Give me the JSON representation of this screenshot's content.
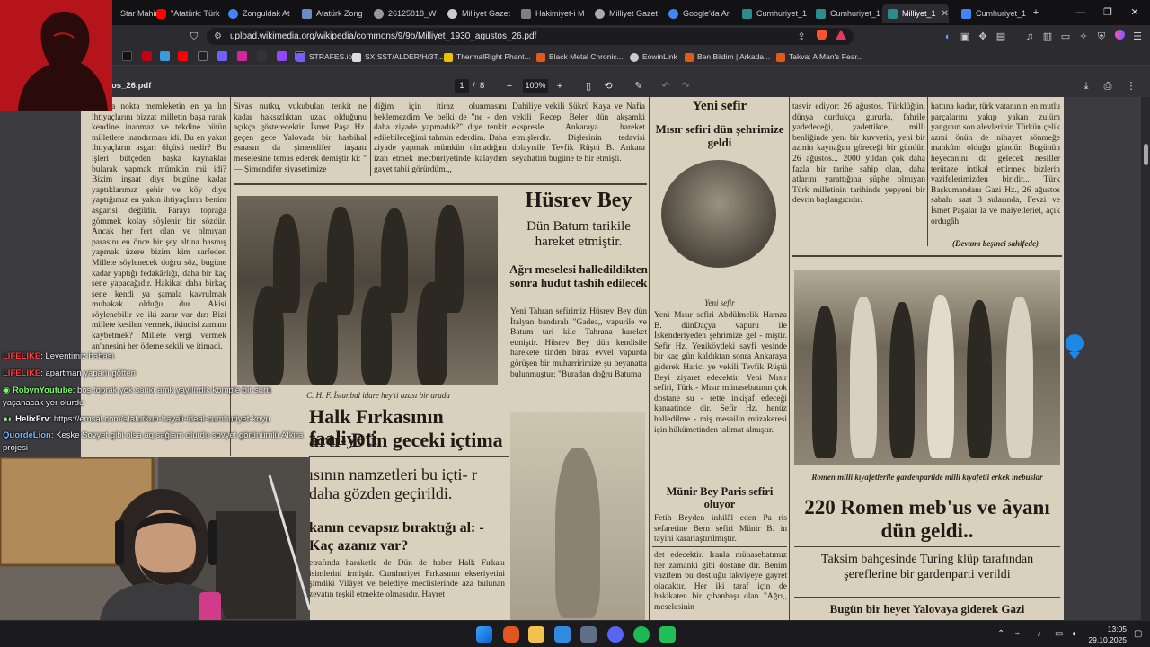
{
  "tabs": [
    {
      "label": "Star Mahir",
      "color": "#e8453c"
    },
    {
      "label": "\"Atatürk: Türk",
      "color": "#ff0000"
    },
    {
      "label": "Zonguldak At",
      "color": "#4285f4"
    },
    {
      "label": "Atatürk Zong",
      "color": "#6d8cc4"
    },
    {
      "label": "26125818_W",
      "color": "#999999"
    },
    {
      "label": "Milliyet Gazet",
      "color": "#cccccc"
    },
    {
      "label": "Hakimiyet-i M",
      "color": "#7f7f7f"
    },
    {
      "label": "Milliyet Gazet",
      "color": "#aaaaaa"
    },
    {
      "label": "Google'da Ar",
      "color": "#4285f4"
    },
    {
      "label": "Cumhuriyet_1",
      "color": "#2e8b8b"
    },
    {
      "label": "Cumhuriyet_1",
      "color": "#2e8b8b"
    },
    {
      "label": "Milliyet_1",
      "color": "#2e8b8b"
    },
    {
      "label": "Cumhuriyet_1",
      "color": "#4285f4"
    }
  ],
  "address": {
    "url": "upload.wikimedia.org/wikipedia/commons/9/9b/Milliyet_1930_agustos_26.pdf"
  },
  "bookmarks": [
    {
      "label": "STRAFES.io",
      "color": "#7a5cff"
    },
    {
      "label": "SX SST/ALDER/H/3T...",
      "color": "#dddddd"
    },
    {
      "label": "ThermalRight Phant...",
      "color": "#f0c000"
    },
    {
      "label": "Black Metal Chronic...",
      "color": "#e05a1c"
    },
    {
      "label": "EowinLink",
      "color": "#cccccc"
    },
    {
      "label": "Ben Bildim | Arkada...",
      "color": "#e05a1c"
    },
    {
      "label": "Takva: A Man's Fear...",
      "color": "#e05a1c"
    }
  ],
  "pdf": {
    "filename": "os_26.pdf",
    "page_current": "1",
    "page_sep": "/",
    "page_total": "8",
    "zoom": "100%",
    "zoom_out": "−",
    "zoom_in": "+"
  },
  "newspaper": {
    "col1_text": "başlıca nokta memleketin en ya lın ihtiyaçlarını bizzat milletin başa rarak kendine inanmaz ve tekdine bütün milletlere inandırması idi. Bu en yakın ihtiyaçların asgari ölçüsü nedir? Bu işleri bütçeden başka kaynaklar bularak yapmak mümkün mü idi? Bizim inşaat diye bugüne kadar yaptıklarımız şehir ve köy diye yaptığımız en yakın ihtiyaçların benim asgarisi değildir. Parayı toprağa gömmek kolay söylenir bir sözdür. Ancak her fert olan ve olmıyan parasını en önce bir şey altına basmış yapmak üzere bizim kim sarfeder. Millete söylenecek doğru söz, bugüne kadar yaptığı fedakârlığı, daha bir kaç sene yapacağıdır. Hakikat daha birkaç sene kendi ya şamala kavrulmak muhakak olduğu dur. Akisi söylenebilir ve iki zarar var dır: Bizi millete kesilen vermek, ikincisi zamanı kaybetmek? Millete vergi vermek an'anesini her ödeme sekili ve itimadi.",
    "col2_top": "Sivas nutku, vukubulan tenkit ne kadar haksızlıktan uzak olduğunu açıkça gösterecektir. İsmet Paşa Hz. geçen gece Yalovada bir hasbihal esnasın da şimendifer inşaatı meselesine temas ederek demiştir ki: \" — Şimendifer siyasetimize",
    "col3_top": "diğim için itiraz olunmasını beklemezdim Ve belki de \"ne - den daha ziyade yapmadık?\" diye tenkit edilebileceğimi tahmin ederdim. Daha ziyade yapmak mümkün olmadığını izah etmek mecburiyetinde kalaydım gayet tabii görürdüm.,,",
    "col4_top": "Dahiliye vekili Şükrü Kaya ve Nafia vekili Recep Beler dün akşamki ekspresle Ankaraya hareket etmişlerdir. Dişlerinin tedavisi dolayısile Tevfik Rüştü B. Ankara seyahatini bugüne te hir etmişti.",
    "photo1_caption": "C. H. F. İstanbul idare hey'ti azası bir arada",
    "husrev_title": "Hüsrev Bey",
    "husrev_sub1": "Dün Batum tarikile hareket etmiştir.",
    "husrev_sub2": "Ağrı meselesi halledildikten sonra hudut tashih edilecek",
    "husrev_text": "Yeni Tahran sefirimiz Hüsrev Bey dün İtalyan bandıralı \"Gadea,, vapurile ve Batum tari kile Tahrana hareket etmiştir. Hüsrev Bey dün kendisile harekete tinden biraz evvel vapurda görüşen bir muharririmize şu beyanatta bulunmuştur: \"Buradan doğru Batuma",
    "firka_head1": "Halk Fırkasının faaliyeti",
    "firka_head2": "artı- Dün geceki içtima",
    "namzet_head": "ısının namzetleri bu içti- r daha gözden geçirildi.",
    "cevap_head": "kanın cevapsız bıraktığı al: - Kaç azanız var?",
    "bottom_text": "etrafında haraketle de Dün de haber Halk Fırkası isimlerini irmiştir. Cumhuriyet Fırkasının ekseriyetini şimdiki Vilâyet ve belediye meclislerinde aza bulunan zevatın teşkil etmekte olmasıdır. Hayret",
    "yeni_sefir": "Yeni sefir",
    "misir_head": "Mısır sefiri dün şehrimize geldi",
    "portrait_caption": "Yeni sefir",
    "misir_text": "Yeni Mısır sefiri Abdülmelik Hamza B. dünDaçya vapuru ile İskenderiyeden şehrimize gel - miştir. Sefir Hz. Yeniköydeki sayfi yesinde bir kaç gün kaldıktan sonra Ankaraya giderek Harici ye vekili Tevfik Rüştü Beyi ziyaret edecektir. Yeni Mısır sefiri, Türk - Mısır münasebatının çok dostane su - rette inkişaf edeceği kanaatinde dir. Sefir Hz. henüz halledilme - miş mesailin müzakeresi için hükümetinden talimat almıştır.",
    "munir_head": "Münir Bey Paris sefiri oluyor",
    "munir_text": "Fetih Beyden inhilâl eden Pa ris sefaretine Bern sefiri Münir B. in tayini kararlaştırılmıştır.",
    "munir_text2": "det edecektir. İranla münasebatımız her zamanki gibi dostane dir. Benim vazifem bu dostluğu takviyeye gayret olacaktır. Her iki taraf için de hakikaten bir çıbanbaşı olan \"Ağrı,, meselesinin",
    "col7_top": "tasvir ediyor: 26 ağustos. Türklüğün, dünya durdukça gururla, fahrile yadedeceği, yadettikce, milli benliğinde yeni bir kuvvetin, yeni bir azmin kaynağını göreceği bir gündür. 26 ağustos... 2000 yıldan çok daha fazla bir tarihe sahip olan, daha atlarını yarattığına şüphe olmıyan Türk milletinin tarihinde yepyeni bir devrin başlangıcıdır.",
    "col8_top": "hattına kadar, türk vatanının en mutlu parçalarını yakıp yakan zulüm yangının son alevlerinin Türkün çelik azmi önün de nihayet sönmeğe mahkûm olduğu gündür. Bugünün heyecanını da gelecek nesiller terütaze intikal ettirmek bizlerin vazifelerimizden biridir... Türk Başkumandanı Gazi Hz., 26 ağustos sabahı saat 3 sularında, Fevzi ve İsmet Paşalar la ve maiyetleriel, açık ordugâh",
    "devami": "(Devamı beşinci sahifede)",
    "romen_caption": "Romen milli kıyafetlerile gardenpartide milli kıyafetli erkek mebuslar",
    "romen_head": "220 Romen meb'us ve âyanı dün geldi..",
    "taksim_head": "Taksim bahçesinde Turing klüp tarafından şereflerine bir gardenparti verildi",
    "bugun_head": "Bugün bir heyet Yalovaya giderek Gazi"
  },
  "chat": [
    {
      "user": "LIFELIKE",
      "user_color": "#ff3b3b",
      "text": ": Leventimiz babası"
    },
    {
      "user": "LIFELIKE",
      "user_color": "#ff3b3b",
      "text": ": apartman yapanı götten"
    },
    {
      "user": "RobynYoutube",
      "user_color": "#7cfc6a",
      "text": ": boş toprak yok sanki amk yayılırdık komple bir sürü"
    },
    {
      "user": "",
      "user_color": "#ffffff",
      "text": "yaşanacak yer olurdu"
    },
    {
      "user": "HelixFrv",
      "user_color": "#ffffff",
      "text": ": https://emsal.com/ataturkun-hayali-ideal-cumhuriyet-koyu"
    },
    {
      "user": "QuordeLion",
      "user_color": "#6ab7ff",
      "text": ": Keşke Sovyet gibi olsa aq sağlam olurdu sovyet görünümlü Afkira"
    },
    {
      "user": "",
      "user_color": "#ffffff",
      "text": "projesi"
    }
  ],
  "taskbar": {
    "time": "13:05",
    "date": "29.10.2025"
  },
  "colors": {
    "browser_bg": "#121214",
    "toolbar_bg": "#2b2b30",
    "pdf_bg": "#3c3c40",
    "paper": "#d9d0bd",
    "cam_red": "#b5151a"
  }
}
